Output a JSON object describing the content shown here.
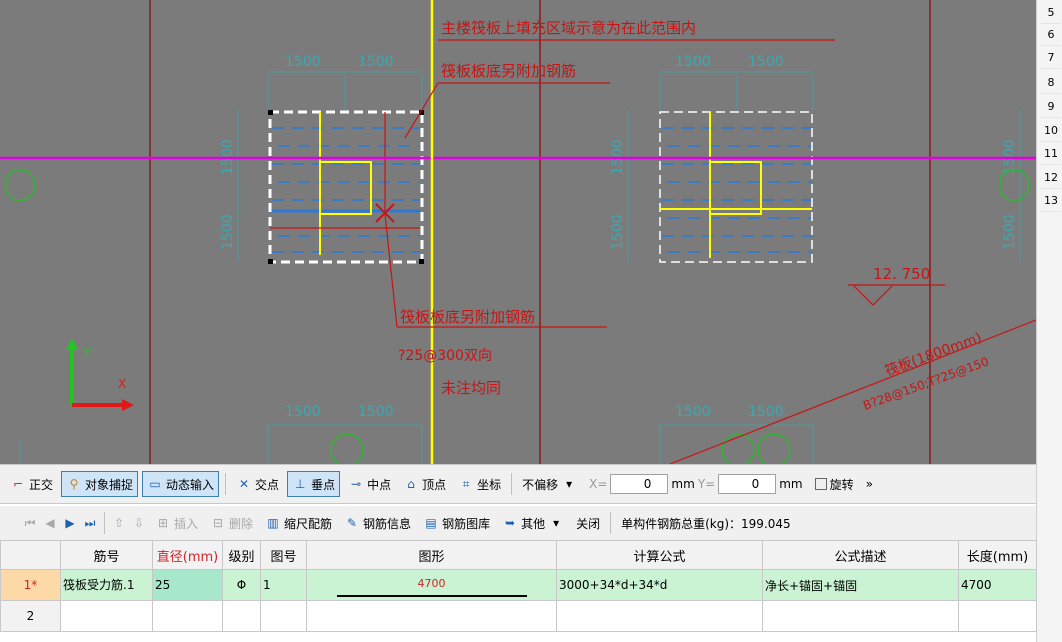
{
  "canvas": {
    "annotations": {
      "fill_note": "主楼筏板上填充区域示意为在此范围内",
      "extra_rebar_top": "筏板板底另附加钢筋",
      "extra_rebar_bottom": "筏板板底另附加钢筋",
      "rebar_spec": "?25@300双向",
      "note_same": "未注均同",
      "elevation": "12. 750",
      "slab_label": "筏板(1800mm)",
      "slab_rebar": "B?28@150;T?25@150"
    },
    "dimensions": [
      "1500",
      "1500"
    ],
    "axis": {
      "x": "X",
      "y": "Y"
    }
  },
  "row_numbers": [
    "5",
    "6",
    "7",
    "8",
    "9",
    "10",
    "11",
    "12",
    "13"
  ],
  "snap_toolbar": {
    "ortho": "正交",
    "object_snap": "对象捕捉",
    "dynamic_input": "动态输入",
    "intersection": "交点",
    "perpendicular": "垂点",
    "midpoint": "中点",
    "vertex": "顶点",
    "coordinate": "坐标",
    "offset_select": "不偏移",
    "x_label": "X=",
    "x_value": "0",
    "x_unit": "mm",
    "y_label": "Y=",
    "y_value": "0",
    "y_unit": "mm",
    "rotate": "旋转",
    "more": "»"
  },
  "grid_toolbar": {
    "insert": "插入",
    "delete": "删除",
    "scale_rebar": "缩尺配筋",
    "rebar_info": "钢筋信息",
    "rebar_library": "钢筋图库",
    "other": "其他",
    "close": "关闭",
    "total_weight": "单构件钢筋总重(kg)：199.045"
  },
  "rebar_table": {
    "headers": [
      "筋号",
      "直径(mm)",
      "级别",
      "图号",
      "图形",
      "计算公式",
      "公式描述",
      "长度(mm)"
    ],
    "rows": [
      {
        "rownum": "1*",
        "name": "筏板受力筋.1",
        "diameter": "25",
        "grade": "Φ",
        "figure_no": "1",
        "shape_value": "4700",
        "formula": "3000+34*d+34*d",
        "description": "净长+锚固+锚固",
        "length": "4700"
      },
      {
        "rownum": "2",
        "name": "",
        "diameter": "",
        "grade": "",
        "figure_no": "",
        "shape_value": "",
        "formula": "",
        "description": "",
        "length": ""
      }
    ]
  },
  "colors": {
    "canvas_bg": "#7b7b7b",
    "axis_magenta": "#e000e0",
    "axis_yellow": "#ffff00",
    "annotation_red": "#c81414",
    "grid_dark_red": "#8a1a1a",
    "selected_row": "#c9f3d2"
  }
}
